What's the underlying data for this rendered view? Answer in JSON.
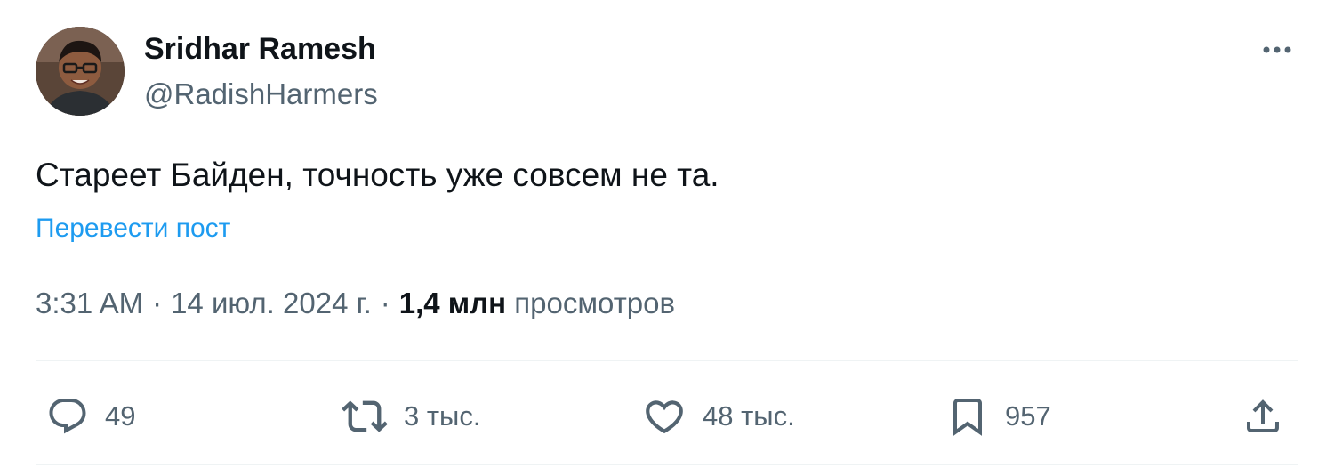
{
  "author": {
    "display_name": "Sridhar Ramesh",
    "handle": "@RadishHarmers"
  },
  "post": {
    "text": "Стареет Байден, точность уже совсем не та.",
    "translate_label": "Перевести пост"
  },
  "meta": {
    "time": "3:31 AM",
    "date": "14 июл. 2024 г.",
    "separator": "·",
    "views_count": "1,4 млн",
    "views_label": "просмотров"
  },
  "actions": {
    "replies": "49",
    "reposts": "3 тыс.",
    "likes": "48 тыс.",
    "bookmarks": "957"
  },
  "icons": {
    "more": "more-horizontal-icon",
    "reply": "reply-bubble-icon",
    "repost": "repost-icon",
    "like": "heart-icon",
    "bookmark": "bookmark-icon",
    "share": "share-upload-icon"
  },
  "colors": {
    "text_primary": "#0f1419",
    "text_secondary": "#536471",
    "link": "#1d9bf0",
    "divider": "#eff3f4"
  }
}
